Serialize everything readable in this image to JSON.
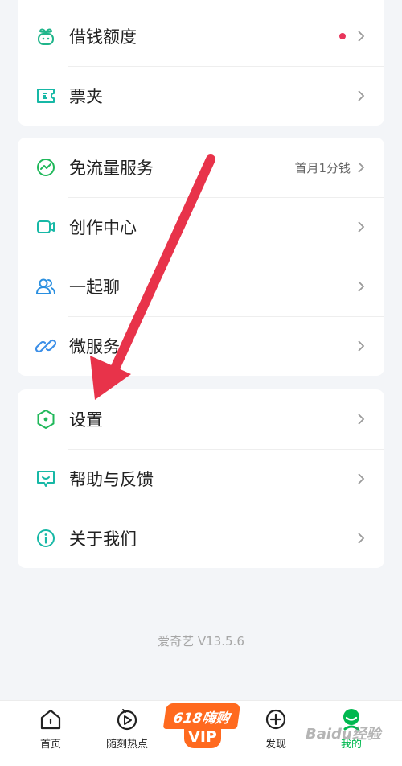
{
  "menu_group_1": [
    {
      "label": "借钱额度",
      "icon": "sprout-icon",
      "badge_dot": true
    },
    {
      "label": "票夹",
      "icon": "ticket-icon"
    }
  ],
  "menu_group_2": [
    {
      "label": "免流量服务",
      "icon": "traffic-free-icon",
      "extra": "首月1分钱"
    },
    {
      "label": "创作中心",
      "icon": "video-camera-icon"
    },
    {
      "label": "一起聊",
      "icon": "people-icon"
    },
    {
      "label": "微服务",
      "icon": "chain-link-icon"
    }
  ],
  "menu_group_3": [
    {
      "label": "设置",
      "icon": "settings-hexagon-icon"
    },
    {
      "label": "帮助与反馈",
      "icon": "feedback-chat-icon"
    },
    {
      "label": "关于我们",
      "icon": "info-icon"
    }
  ],
  "version": "爱奇艺 V13.5.6",
  "tabbar": {
    "home": "首页",
    "hot": "随刻热点",
    "vip_top": "618嗨购",
    "vip_bottom": "VIP",
    "discover": "发现",
    "mine": "我的"
  },
  "watermark": "Baidu经验",
  "colors": {
    "accent_green": "#00b84f",
    "icon_teal": "#17b8a6",
    "badge_red": "#e8355b",
    "arrow_red": "#e8334a",
    "vip_orange": "#ff6a1f"
  }
}
